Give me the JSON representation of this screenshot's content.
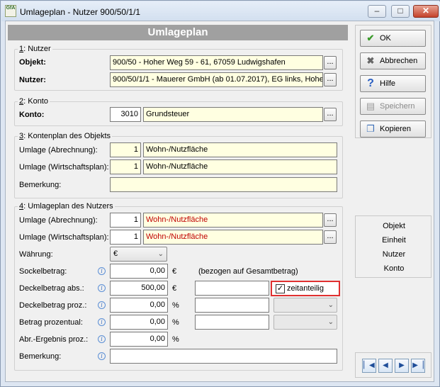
{
  "window": {
    "title": "Umlageplan - Nutzer 900/50/1/1",
    "app_icon_text": "GfA",
    "minimize": "–",
    "maximize": "□",
    "close": "✕"
  },
  "header": "Umlageplan",
  "nutzer_group": {
    "title_num": "1",
    "title_rest": ": Nutzer",
    "objekt_label": "Objekt:",
    "objekt_value": "900/50 - Hoher Weg 59 - 61, 67059 Ludwigshafen",
    "nutzer_label": "Nutzer:",
    "nutzer_value": "900/50/1/1 - Mauerer GmbH  (ab 01.07.2017), EG links, Hohe",
    "ellipsis": "..."
  },
  "konto_group": {
    "title_num": "2",
    "title_rest": ": Konto",
    "konto_label": "Konto:",
    "konto_number": "3010",
    "konto_name": "Grundsteuer",
    "ellipsis": "..."
  },
  "kontenplan_group": {
    "title_num": "3",
    "title_rest": ": Kontenplan des Objekts",
    "umlage_abr_label": "Umlage (Abrechnung):",
    "umlage_abr_num": "1",
    "umlage_abr_text": "Wohn-/Nutzfläche",
    "umlage_wp_label": "Umlage (Wirtschaftsplan):",
    "umlage_wp_num": "1",
    "umlage_wp_text": "Wohn-/Nutzfläche",
    "bemerkung_label": "Bemerkung:",
    "bemerkung_value": ""
  },
  "umlageplan_group": {
    "title_num": "4",
    "title_rest": ": Umlageplan des Nutzers",
    "umlage_abr_label": "Umlage (Abrechnung):",
    "umlage_abr_num": "1",
    "umlage_abr_text": "Wohn-/Nutzfläche",
    "umlage_wp_label": "Umlage (Wirtschaftsplan):",
    "umlage_wp_num": "1",
    "umlage_wp_text": "Wohn-/Nutzfläche",
    "waehrung_label": "Währung:",
    "waehrung_value": "€",
    "sockel_label": "Sockelbetrag:",
    "sockel_value": "0,00",
    "sockel_unit": "€",
    "sockel_note": "(bezogen auf Gesamtbetrag)",
    "deckel_abs_label": "Deckelbetrag abs.:",
    "deckel_abs_value": "500,00",
    "deckel_abs_unit": "€",
    "deckel_abs_extra": "",
    "zeitanteilig_label": "zeitanteilig",
    "zeitanteilig_checked": true,
    "deckel_proz_label": "Deckelbetrag proz.:",
    "deckel_proz_value": "0,00",
    "deckel_proz_unit": "%",
    "betrag_proz_label": "Betrag prozentual:",
    "betrag_proz_value": "0,00",
    "betrag_proz_unit": "%",
    "abr_ergebnis_label": "Abr.-Ergebnis proz.:",
    "abr_ergebnis_value": "0,00",
    "abr_ergebnis_unit": "%",
    "bemerkung_label": "Bemerkung:",
    "bemerkung_value": "",
    "info_glyph": "i",
    "ellipsis": "..."
  },
  "buttons": {
    "ok": "OK",
    "abbrechen": "Abbrechen",
    "hilfe": "Hilfe",
    "speichern": "Speichern",
    "kopieren": "Kopieren"
  },
  "nav_links": [
    "Objekt",
    "Einheit",
    "Nutzer",
    "Konto"
  ],
  "record_nav": {
    "first": "▏◀",
    "prev": "◀",
    "next": "▶",
    "last": "▶▕"
  },
  "colors": {
    "input_readonly": "#ffffe1",
    "red_text": "#c00000",
    "highlight_border": "#e03030",
    "header_bg": "#a0a0a0"
  }
}
